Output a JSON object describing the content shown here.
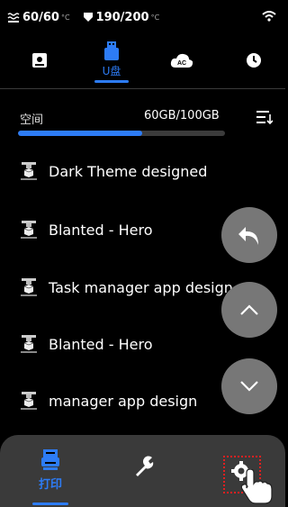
{
  "status": {
    "nozzle_temp": "60/60",
    "nozzle_unit": "°C",
    "bed_temp": "190/200",
    "bed_unit": "°C"
  },
  "tabs": [
    {
      "name": "local",
      "icon": "storage-icon",
      "label": ""
    },
    {
      "name": "usb",
      "icon": "usb-icon",
      "label": "U盘",
      "active": true
    },
    {
      "name": "cloud",
      "icon": "ac-cloud-icon",
      "label": ""
    },
    {
      "name": "history",
      "icon": "clock-icon",
      "label": ""
    }
  ],
  "storage": {
    "label": "空间",
    "value": "60GB/100GB",
    "used_fraction": 0.6
  },
  "files": [
    "Dark Theme designed",
    "Blanted - Hero",
    "Task manager app design",
    "Blanted - Hero",
    "manager app design"
  ],
  "bottom_tabs": [
    {
      "name": "print",
      "icon": "print-icon",
      "label": "打印",
      "active": true
    },
    {
      "name": "tools",
      "icon": "wrench-icon",
      "label": ""
    },
    {
      "name": "settings",
      "icon": "gear-icon",
      "label": ""
    }
  ],
  "colors": {
    "accent": "#2d7cf6",
    "background": "#000000",
    "panel": "#3a3a3a",
    "fab": "#777777",
    "highlight": "#e02020"
  }
}
